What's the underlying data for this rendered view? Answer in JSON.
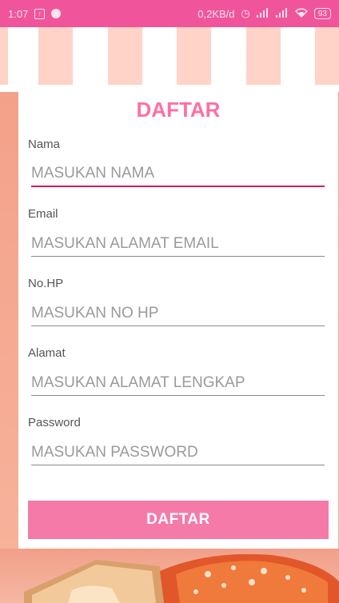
{
  "status_bar": {
    "time": "1:07",
    "network_speed": "0,2KB/d",
    "battery": "93",
    "icons": [
      "notification-icon",
      "app-icon",
      "alarm-icon",
      "signal-icon",
      "signal-icon",
      "wifi-icon",
      "battery-icon"
    ]
  },
  "form": {
    "title": "DAFTAR",
    "fields": [
      {
        "label": "Nama",
        "placeholder": "MASUKAN NAMA"
      },
      {
        "label": "Email",
        "placeholder": "MASUKAN ALAMAT EMAIL"
      },
      {
        "label": "No.HP",
        "placeholder": "MASUKAN NO HP"
      },
      {
        "label": "Alamat",
        "placeholder": "MASUKAN ALAMAT LENGKAP"
      },
      {
        "label": "Password",
        "placeholder": "MASUKAN PASSWORD"
      }
    ],
    "submit_label": "DAFTAR"
  },
  "colors": {
    "status_bar": "#f0559b",
    "title": "#ff6fa4",
    "button": "#f57aa8",
    "active_underline": "#d81b60",
    "background_peach": "#f4a189"
  }
}
